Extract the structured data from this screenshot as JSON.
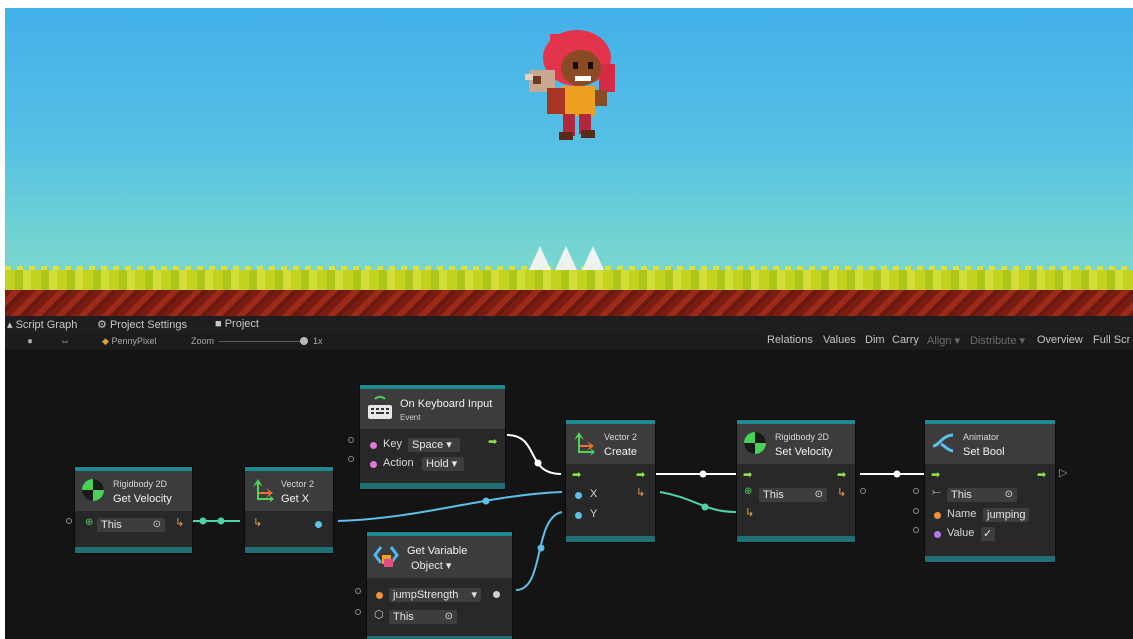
{
  "tabs": {
    "script_graph": "Script Graph",
    "project_settings": "Project Settings",
    "project": "Project"
  },
  "toolbar": {
    "object_name": "PennyPixel",
    "zoom_label": "Zoom",
    "zoom_value": "1x",
    "relations": "Relations",
    "values": "Values",
    "dim": "Dim",
    "carry": "Carry",
    "align": "Align ▾",
    "distribute": "Distribute ▾",
    "overview": "Overview",
    "full_screen": "Full Scr"
  },
  "nodes": {
    "get_velocity": {
      "category": "Rigidbody 2D",
      "title": "Get Velocity",
      "target": "This"
    },
    "get_x": {
      "category": "Vector 2",
      "title": "Get X"
    },
    "keyboard": {
      "title": "On Keyboard Input",
      "subtitle": "Event",
      "key_label": "Key",
      "key_value": "Space",
      "action_label": "Action",
      "action_value": "Hold"
    },
    "get_variable": {
      "title": "Get Variable",
      "kind": "Object",
      "variable": "jumpStrength",
      "target": "This"
    },
    "create": {
      "category": "Vector 2",
      "title": "Create",
      "x_label": "X",
      "y_label": "Y"
    },
    "set_velocity": {
      "category": "Rigidbody 2D",
      "title": "Set Velocity",
      "target": "This"
    },
    "set_bool": {
      "category": "Animator",
      "title": "Set Bool",
      "target": "This",
      "name_label": "Name",
      "name_value": "jumping",
      "value_label": "Value",
      "value_checked": "✓"
    }
  },
  "colors": {
    "node_border": "#1b8a92",
    "flow_port": "#8fe64c",
    "float_port": "#5ec0e8",
    "object_port": "#f0902c",
    "string_port": "#f09040",
    "bool_port": "#b07ae8",
    "key_port": "#e07ad8"
  }
}
